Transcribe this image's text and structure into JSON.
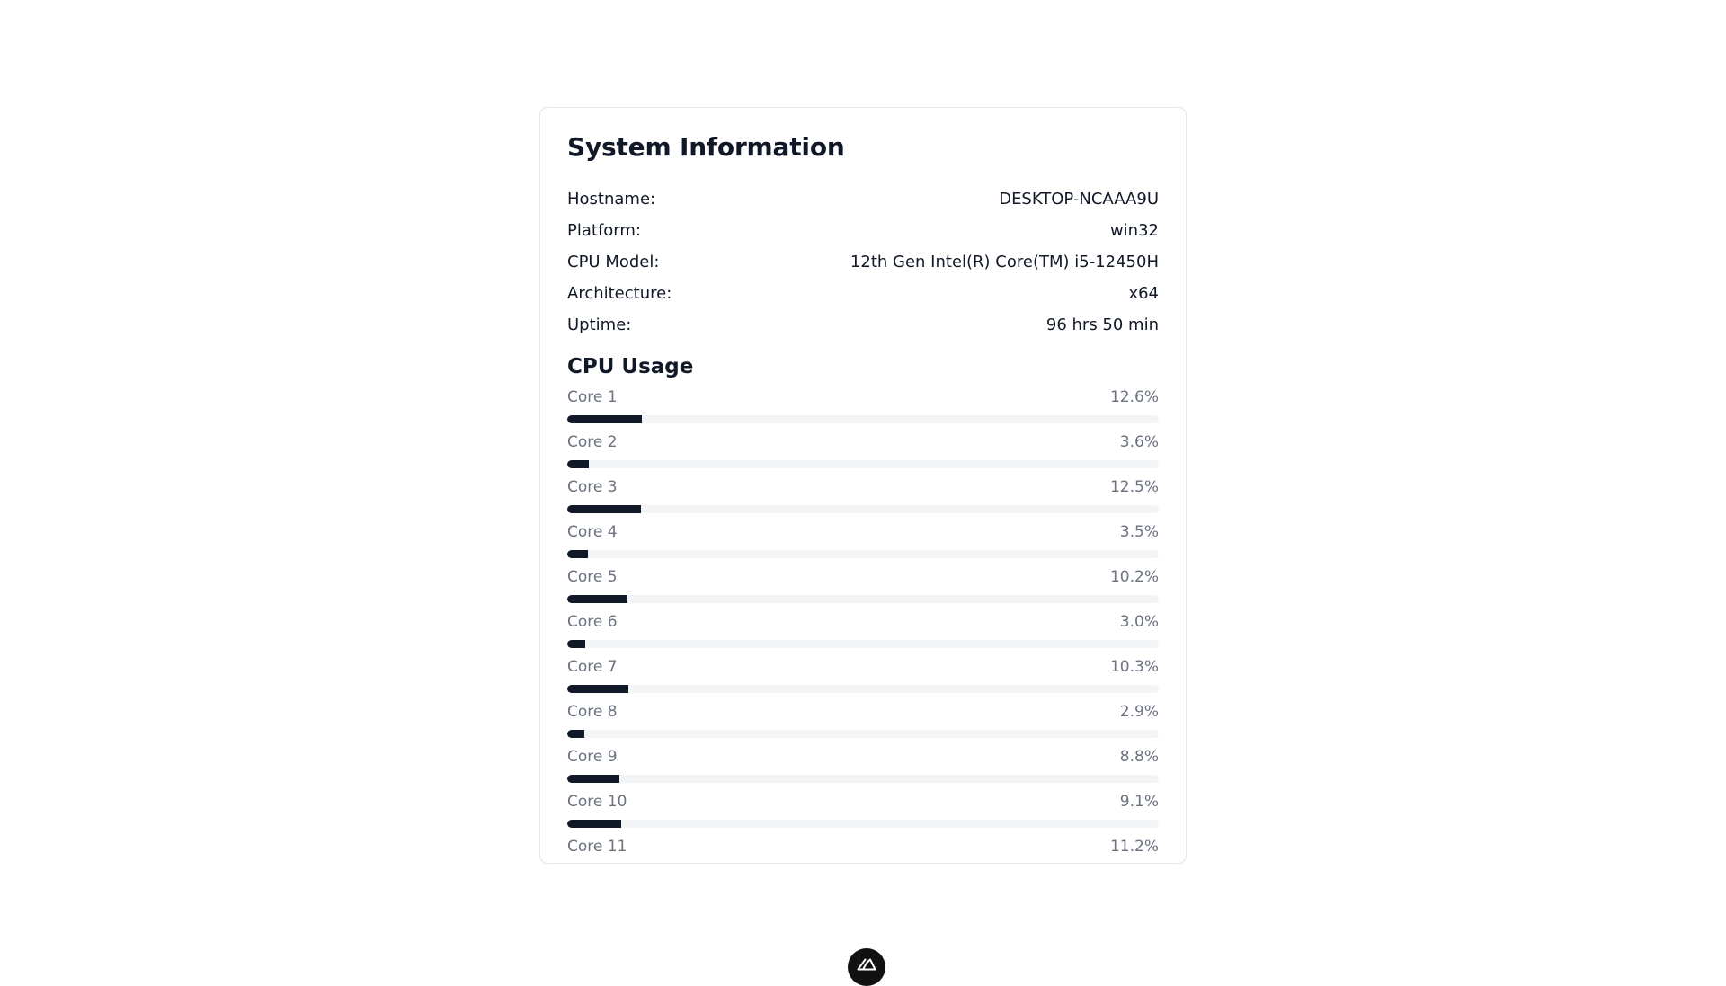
{
  "card": {
    "title": "System Information",
    "info": [
      {
        "label": "Hostname:",
        "value": "DESKTOP-NCAAA9U"
      },
      {
        "label": "Platform:",
        "value": "win32"
      },
      {
        "label": "CPU Model:",
        "value": "12th Gen Intel(R) Core(TM) i5-12450H"
      },
      {
        "label": "Architecture:",
        "value": "x64"
      },
      {
        "label": "Uptime:",
        "value": "96 hrs 50 min"
      }
    ],
    "cpu_section_title": "CPU Usage",
    "cores": [
      {
        "label": "Core 1",
        "value": "12.6%",
        "usage": 12.6
      },
      {
        "label": "Core 2",
        "value": "3.6%",
        "usage": 3.6
      },
      {
        "label": "Core 3",
        "value": "12.5%",
        "usage": 12.5
      },
      {
        "label": "Core 4",
        "value": "3.5%",
        "usage": 3.5
      },
      {
        "label": "Core 5",
        "value": "10.2%",
        "usage": 10.2
      },
      {
        "label": "Core 6",
        "value": "3.0%",
        "usage": 3.0
      },
      {
        "label": "Core 7",
        "value": "10.3%",
        "usage": 10.3
      },
      {
        "label": "Core 8",
        "value": "2.9%",
        "usage": 2.9
      },
      {
        "label": "Core 9",
        "value": "8.8%",
        "usage": 8.8
      },
      {
        "label": "Core 10",
        "value": "9.1%",
        "usage": 9.1
      },
      {
        "label": "Core 11",
        "value": "11.2%",
        "usage": 11.2
      }
    ]
  },
  "floating_button": {
    "icon": "nuxt-logo-icon"
  },
  "colors": {
    "bar_fill": "#111827",
    "bar_track": "#f3f4f6",
    "muted_text": "#6b7280",
    "card_border": "#e5e7eb"
  }
}
